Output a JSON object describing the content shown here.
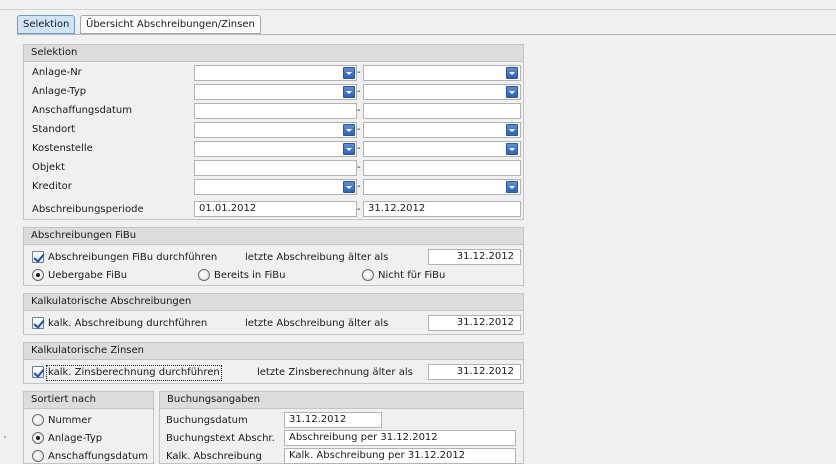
{
  "tabs": [
    {
      "label": "Selektion",
      "active": true
    },
    {
      "label": "Übersicht Abschreibungen/Zinsen",
      "active": false
    }
  ],
  "selektion": {
    "title": "Selektion",
    "separator": "-",
    "rows": [
      {
        "label": "Anlage-Nr",
        "from": "",
        "to": "",
        "dropdown": true
      },
      {
        "label": "Anlage-Typ",
        "from": "",
        "to": "",
        "dropdown": true
      },
      {
        "label": "Anschaffungsdatum",
        "from": "",
        "to": "",
        "dropdown": false
      },
      {
        "label": "Standort",
        "from": "",
        "to": "",
        "dropdown": true
      },
      {
        "label": "Kostenstelle",
        "from": "",
        "to": "",
        "dropdown": true
      },
      {
        "label": "Objekt",
        "from": "",
        "to": "",
        "dropdown": false
      },
      {
        "label": "Kreditor",
        "from": "",
        "to": "",
        "dropdown": true
      },
      {
        "label": "Abschreibungsperiode",
        "from": "01.01.2012",
        "to": "31.12.2012",
        "dropdown": false
      }
    ]
  },
  "fibu": {
    "title": "Abschreibungen FiBu",
    "checkbox_label": "Abschreibungen FiBu durchführen",
    "checked": true,
    "older_label": "letzte Abschreibung älter als",
    "date": "31.12.2012",
    "radios": [
      {
        "label": "Uebergabe FiBu",
        "checked": true
      },
      {
        "label": "Bereits in FiBu",
        "checked": false
      },
      {
        "label": "Nicht für FiBu",
        "checked": false
      }
    ]
  },
  "kalk_abschreibungen": {
    "title": "Kalkulatorische Abschreibungen",
    "checkbox_label": "kalk. Abschreibung durchführen",
    "checked": true,
    "older_label": "letzte Abschreibung älter als",
    "date": "31.12.2012"
  },
  "kalk_zinsen": {
    "title": "Kalkulatorische Zinsen",
    "checkbox_label": "kalk. Zinsberechnung durchführen",
    "checked": true,
    "older_label": "letzte Zinsberechnung älter als",
    "date": "31.12.2012"
  },
  "sortiert": {
    "title": "Sortiert nach",
    "options": [
      {
        "label": "Nummer",
        "checked": false
      },
      {
        "label": "Anlage-Typ",
        "checked": true
      },
      {
        "label": "Anschaffungsdatum",
        "checked": false
      }
    ]
  },
  "buchung": {
    "title": "Buchungsangaben",
    "datum_label": "Buchungsdatum",
    "datum": "31.12.2012",
    "text_label": "Buchungstext Abschr.",
    "text": "Abschreibung per 31.12.2012",
    "kalk_label": "Kalk. Abschreibung",
    "kalk_text": "Kalk. Abschreibung per 31.12.2012"
  }
}
